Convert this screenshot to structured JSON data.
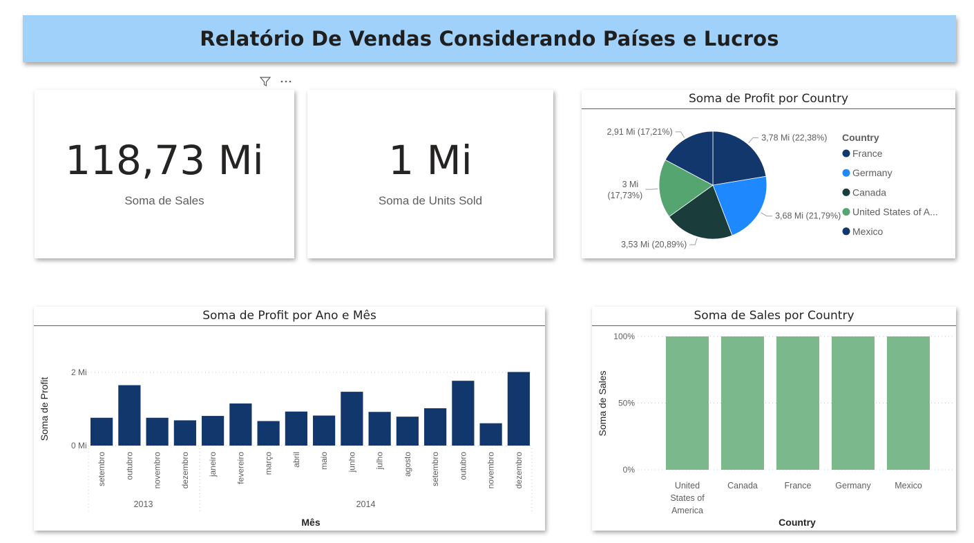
{
  "header": {
    "title": "Relatório De Vendas Considerando Países e Lucros"
  },
  "kpi_sales": {
    "value": "118,73 Mi",
    "label": "Soma de  Sales"
  },
  "kpi_units": {
    "value": "1 Mi",
    "label": "Soma de Units Sold"
  },
  "toolbar": {
    "filter_icon": "filter-icon",
    "more_icon": "more-options-icon"
  },
  "chart_data": [
    {
      "type": "pie",
      "title": "Soma de Profit por Country",
      "legend_title": "Country",
      "legend_position": "right",
      "slices": [
        {
          "name": "France",
          "value": 3.78,
          "label": "3,78 Mi (22,38%)",
          "color": "#12376d"
        },
        {
          "name": "Germany",
          "value": 3.68,
          "label": "3,68 Mi (21,79%)",
          "color": "#1e88ff"
        },
        {
          "name": "Canada",
          "value": 3.53,
          "label": "3,53 Mi (20,89%)",
          "color": "#1a3d3b"
        },
        {
          "name": "United States of America",
          "legend_label": "United States of A...",
          "value": 2.99,
          "label_line1": "3 Mi",
          "label_line2": "(17,73%)",
          "color": "#55a570"
        },
        {
          "name": "Mexico",
          "value": 2.91,
          "label": "2,91 Mi (17,21%)",
          "color": "#12376d"
        }
      ]
    },
    {
      "type": "bar",
      "title": "Soma de Profit por Ano e Mês",
      "xlabel": "Mês",
      "ylabel": "Soma de Profit",
      "ylim": [
        0,
        2.0
      ],
      "y_ticks": [
        {
          "value": 0,
          "label": "0 Mi"
        },
        {
          "value": 2,
          "label": "2 Mi"
        }
      ],
      "color": "#12376d",
      "categories": [
        "setembro",
        "outubro",
        "novembro",
        "dezembro",
        "janeiro",
        "fevereiro",
        "março",
        "abril",
        "maio",
        "junho",
        "julho",
        "agosto",
        "setembro",
        "outubro",
        "novembro",
        "dezembro"
      ],
      "values": [
        0.76,
        1.65,
        0.76,
        0.69,
        0.81,
        1.15,
        0.67,
        0.93,
        0.82,
        1.47,
        0.92,
        0.79,
        1.02,
        1.77,
        0.61,
        2.01
      ],
      "years": [
        {
          "label": "2013",
          "count": 4
        },
        {
          "label": "2014",
          "count": 12
        }
      ]
    },
    {
      "type": "bar",
      "title": "Soma de Sales por Country",
      "xlabel": "Country",
      "ylabel": "Soma de Sales",
      "ylim": [
        0,
        100
      ],
      "y_ticks": [
        {
          "value": 0,
          "label": "0%"
        },
        {
          "value": 50,
          "label": "50%"
        },
        {
          "value": 100,
          "label": "100%"
        }
      ],
      "color": "#7bb98d",
      "categories": [
        "United States of America",
        "Canada",
        "France",
        "Germany",
        "Mexico"
      ],
      "category_lines": [
        [
          "United",
          "States of",
          "America"
        ],
        [
          "Canada"
        ],
        [
          "France"
        ],
        [
          "Germany"
        ],
        [
          "Mexico"
        ]
      ],
      "values": [
        100,
        100,
        100,
        100,
        100
      ]
    }
  ]
}
